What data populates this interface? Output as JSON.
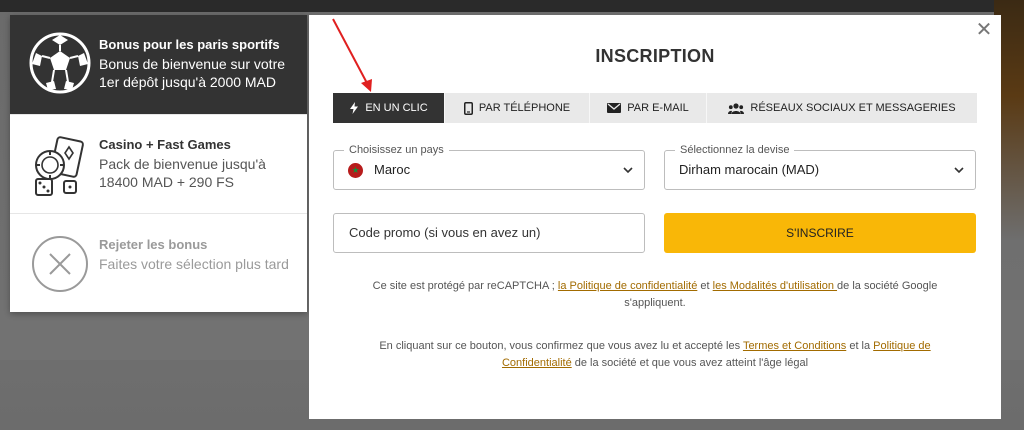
{
  "bonus": {
    "sports": {
      "title": "Bonus pour les paris sportifs",
      "desc": "Bonus de bienvenue sur votre 1er dépôt jusqu'à 2000 MAD",
      "icon": "soccer-ball-icon"
    },
    "casino": {
      "title": "Casino + Fast Games",
      "desc": "Pack de bienvenue jusqu'à 18400 MAD + 290 FS",
      "icon": "casino-chips-cards-icon"
    },
    "reject": {
      "title": "Rejeter les bonus",
      "desc": "Faites votre sélection plus tard",
      "icon": "close-circle-icon"
    }
  },
  "modal": {
    "title": "INSCRIPTION",
    "close_icon": "close-icon",
    "tabs": [
      {
        "label": "EN UN CLIC",
        "icon": "lightning-icon",
        "active": true
      },
      {
        "label": "PAR TÉLÉPHONE",
        "icon": "phone-icon",
        "active": false
      },
      {
        "label": "PAR E-MAIL",
        "icon": "envelope-icon",
        "active": false
      },
      {
        "label": "RÉSEAUX SOCIAUX ET MESSAGERIES",
        "icon": "users-icon",
        "active": false
      }
    ],
    "country": {
      "legend": "Choisissez un pays",
      "value": "Maroc",
      "flag_icon": "morocco-flag-icon"
    },
    "currency": {
      "legend": "Sélectionnez la devise",
      "value": "Dirham marocain (MAD)"
    },
    "promo": {
      "placeholder": "Code promo (si vous en avez un)"
    },
    "submit_label": "S'INSCRIRE",
    "recaptcha": {
      "prefix": "Ce site est protégé par reCAPTCHA ; ",
      "privacy_link": "la Politique de confidentialité",
      "mid": " et ",
      "terms_link": "les Modalités d'utilisation ",
      "suffix": "de la société Google s'appliquent."
    },
    "consent": {
      "prefix": "En cliquant sur ce bouton, vous confirmez que vous avez lu et accepté les ",
      "terms_link": "Termes et Conditions",
      "mid": " et la ",
      "privacy_link": "Politique de Confidentialité",
      "suffix": " de la société et que vous avez atteint l'âge légal"
    }
  },
  "colors": {
    "accent": "#f9b707",
    "active_tab": "#333333",
    "link": "#a26b00",
    "annotation": "#e02020"
  }
}
